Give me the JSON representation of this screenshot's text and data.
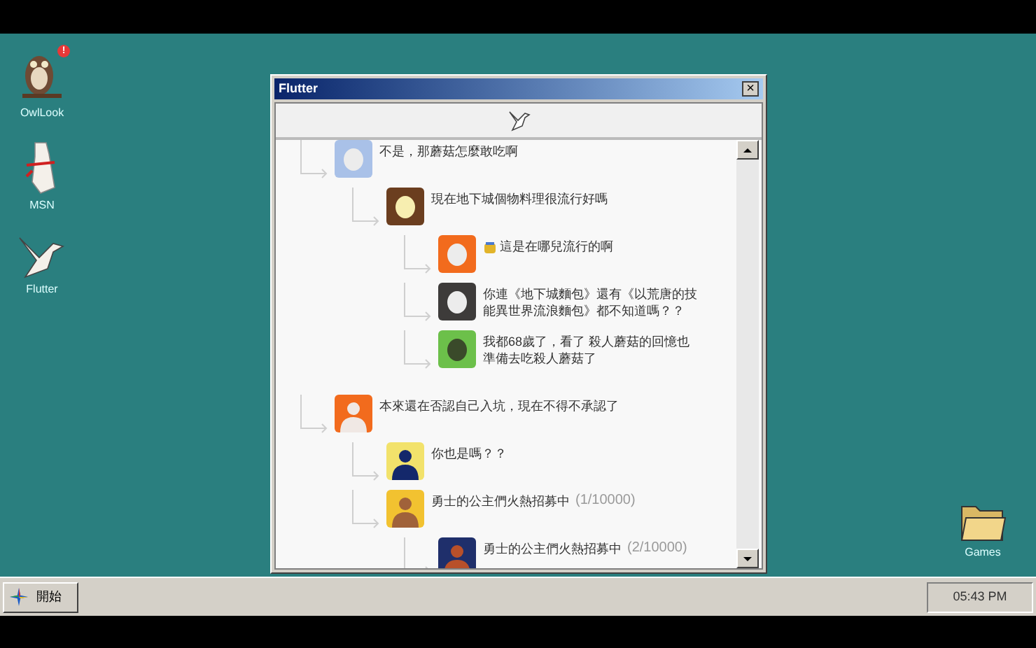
{
  "desktop_icons": [
    {
      "label": "OwlLook",
      "kind": "owl",
      "badge": "!"
    },
    {
      "label": "MSN",
      "kind": "scroll"
    },
    {
      "label": "Flutter",
      "kind": "bird"
    },
    {
      "label": "Games",
      "kind": "folder"
    }
  ],
  "window": {
    "title": "Flutter",
    "close": "×"
  },
  "thread": [
    {
      "text": "不是，那蘑菇怎麼敢吃啊",
      "color": "#a9c1e8",
      "avatar": {
        "kind": "egg",
        "color": "#ececec"
      },
      "children": [
        {
          "text": "現在地下城個物料理很流行好嗎",
          "color": "#6b3e1f",
          "avatar": {
            "kind": "egg",
            "color": "#f7eeb0"
          },
          "children": [
            {
              "text": "這是在哪兒流行的啊",
              "color": "#f26b1d",
              "avatar": {
                "kind": "egg",
                "color": "#ececec"
              },
              "emoji": true
            },
            {
              "text": "你連《地下城麵包》還有《以荒唐的技能異世界流浪麵包》都不知道嗎？？",
              "color": "#3d3b3a",
              "avatar": {
                "kind": "egg",
                "color": "#ececec"
              }
            },
            {
              "text": "我都68歲了，看了 殺人蘑菇的回憶也準備去吃殺人蘑菇了",
              "color": "#6cc04a",
              "avatar": {
                "kind": "egg",
                "color": "#3a4a2a"
              }
            }
          ]
        }
      ]
    },
    {
      "text": "本來還在否認自己入坑，現在不得不承認了",
      "color": "#f26b1d",
      "avatar": {
        "kind": "person",
        "color": "#f0e8e4"
      },
      "children": [
        {
          "text": "你也是嗎？？",
          "color": "#f2e26b",
          "avatar": {
            "kind": "person",
            "color": "#14286b"
          }
        },
        {
          "text": "勇士的公主們火熱招募中",
          "count": "(1/10000)",
          "color": "#f2c230",
          "avatar": {
            "kind": "person",
            "color": "#a0623a"
          },
          "children": [
            {
              "text": "勇士的公主們火熱招募中",
              "count": "(2/10000)",
              "color": "#1f2f6b",
              "avatar": {
                "kind": "person",
                "color": "#b8502a"
              }
            }
          ]
        }
      ]
    }
  ],
  "taskbar": {
    "start": "開始",
    "clock": "05:43 PM"
  }
}
